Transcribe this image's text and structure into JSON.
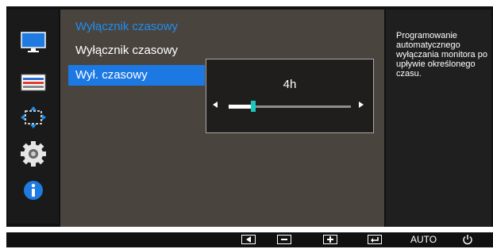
{
  "menu": {
    "title": "Wyłącznik czasowy",
    "items": [
      {
        "label": "Wyłącznik czasowy",
        "selected": false
      },
      {
        "label": "Wył. czasowy",
        "selected": true
      }
    ]
  },
  "popup": {
    "value": "4h",
    "slider_fraction": 0.2
  },
  "description": {
    "text": "Programowanie automatycznego wyłączania monitora po upływie określonego czasu."
  },
  "sidebar": {
    "icons": [
      "picture-icon",
      "onscreen-display-icon",
      "position-size-icon",
      "system-gear-icon",
      "information-icon"
    ],
    "selected_index": null
  },
  "keyguide": {
    "auto_label": "AUTO"
  },
  "colors": {
    "accent": "#1c79e4",
    "title": "#1e8ef0",
    "slider_thumb": "#19c8c0",
    "menu_bg": "#4a443f"
  }
}
